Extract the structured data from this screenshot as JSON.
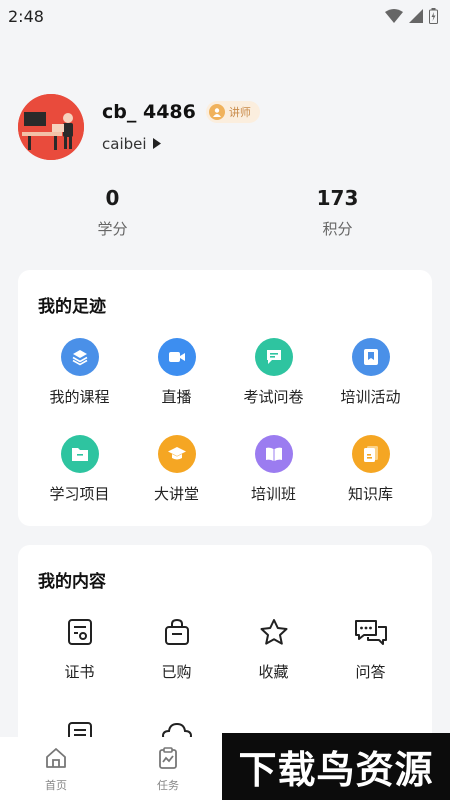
{
  "status_bar": {
    "time": "2:48"
  },
  "profile": {
    "username": "cb_ 4486",
    "role": "讲师",
    "organization": "caibei"
  },
  "stats": [
    {
      "value": "0",
      "label": "学分"
    },
    {
      "value": "173",
      "label": "积分"
    }
  ],
  "footprint": {
    "title": "我的足迹",
    "items": [
      {
        "label": "我的课程",
        "icon": "layers-icon",
        "color": "#4a90e8"
      },
      {
        "label": "直播",
        "icon": "video-icon",
        "color": "#3d8ef0"
      },
      {
        "label": "考试问卷",
        "icon": "message-icon",
        "color": "#2ec4a0"
      },
      {
        "label": "培训活动",
        "icon": "bookmark-icon",
        "color": "#4a90e8"
      },
      {
        "label": "学习项目",
        "icon": "folder-icon",
        "color": "#2ec4a0"
      },
      {
        "label": "大讲堂",
        "icon": "graduation-cap-icon",
        "color": "#f5a623"
      },
      {
        "label": "培训班",
        "icon": "book-icon",
        "color": "#9b7cf0"
      },
      {
        "label": "知识库",
        "icon": "document-icon",
        "color": "#f5a623"
      }
    ]
  },
  "content": {
    "title": "我的内容",
    "items": [
      {
        "label": "证书",
        "icon": "certificate-icon"
      },
      {
        "label": "已购",
        "icon": "shopping-bag-icon"
      },
      {
        "label": "收藏",
        "icon": "star-icon"
      },
      {
        "label": "问答",
        "icon": "chat-icon"
      },
      {
        "label": "",
        "icon": "list-icon"
      },
      {
        "label": "",
        "icon": "cloud-icon"
      }
    ]
  },
  "tabbar": [
    {
      "label": "首页",
      "icon": "home-icon"
    },
    {
      "label": "任务",
      "icon": "task-icon"
    }
  ],
  "watermark": {
    "text": "下载鸟资源"
  }
}
